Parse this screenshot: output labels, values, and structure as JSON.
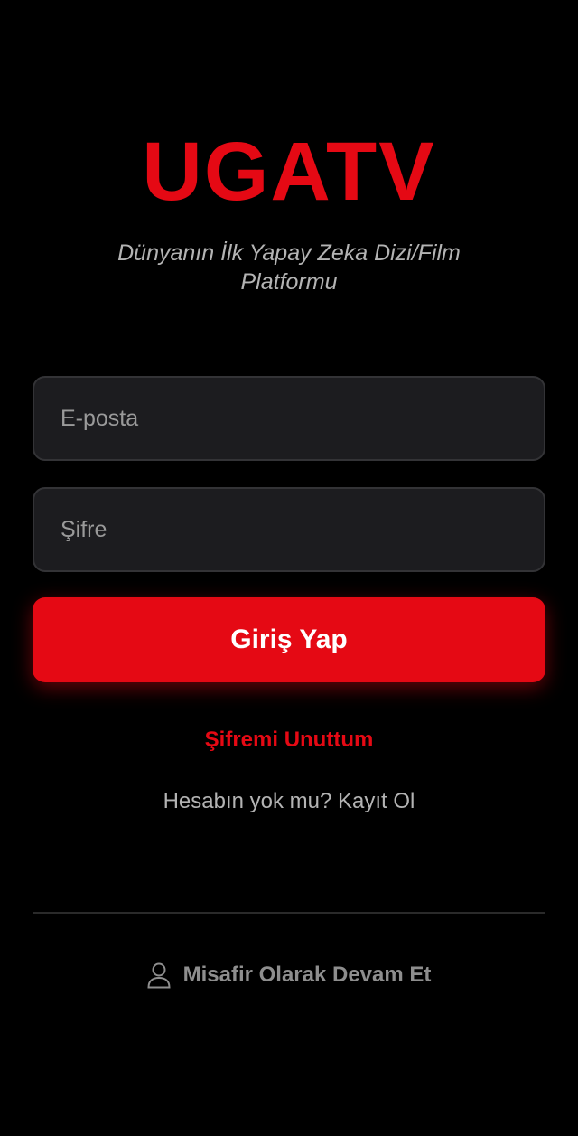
{
  "app": {
    "logo": "UGATV",
    "tagline": "Dünyanın İlk Yapay Zeka Dizi/Film Platformu"
  },
  "form": {
    "email_placeholder": "E-posta",
    "password_placeholder": "Şifre",
    "login_label": "Giriş Yap",
    "forgot_label": "Şifremi Unuttum",
    "no_account_text": "Hesabın yok mu?",
    "register_label": "Kayıt Ol"
  },
  "guest": {
    "label": "Misafir Olarak Devam Et",
    "icon": "user-icon"
  },
  "colors": {
    "accent": "#e50914",
    "background": "#000000",
    "field_background": "#1c1c1f",
    "muted_text": "#b3b3b3"
  }
}
